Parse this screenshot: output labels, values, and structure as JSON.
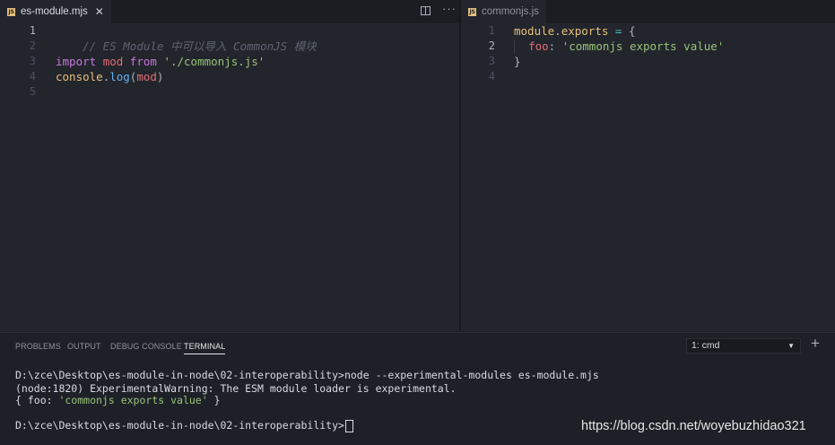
{
  "tabs": {
    "left": {
      "label": "es-module.mjs",
      "icon": "js-file-icon"
    },
    "right": {
      "label": "commonjs.js",
      "icon": "js-file-icon"
    },
    "close": "✕",
    "more": "···",
    "js_badge": "JS"
  },
  "left_editor": {
    "line_numbers": [
      "1",
      "2",
      "3",
      "4",
      "5"
    ],
    "line1_comment": "// ES Module 中可以导入 CommonJS 模块",
    "line3": {
      "kw1": "import",
      "var": "mod",
      "kw2": "from",
      "str": "'./commonjs.js'"
    },
    "line4": {
      "obj": "console",
      "dot": ".",
      "fn": "log",
      "open": "(",
      "var": "mod",
      "close": ")"
    }
  },
  "right_editor": {
    "line_numbers": [
      "1",
      "2",
      "3",
      "4"
    ],
    "line1": {
      "obj": "module",
      "dot": ".",
      "prop": "exports",
      "eq": " = ",
      "brace": "{"
    },
    "line2": {
      "prop": "foo",
      "colon": ": ",
      "str": "'commonjs exports value'"
    },
    "line3": "}"
  },
  "panel": {
    "tabs": [
      "PROBLEMS",
      "OUTPUT",
      "DEBUG CONSOLE",
      "TERMINAL"
    ],
    "terminal_select": "1: cmd",
    "plus": "+",
    "terminal_lines": [
      "D:\\zce\\Desktop\\es-module-in-node\\02-interoperability>node --experimental-modules es-module.mjs",
      "(node:1820) ExperimentalWarning: The ESM module loader is experimental.",
      "",
      "",
      "D:\\zce\\Desktop\\es-module-in-node\\02-interoperability>"
    ],
    "output_line": {
      "open": "{ foo: ",
      "str": "'commonjs exports value'",
      "close": " }"
    }
  },
  "watermark": "https://blog.csdn.net/woyebuzhidao321",
  "colors": {
    "background": "#23252c",
    "keyword": "#c678dd",
    "string": "#98c379",
    "variable": "#e06c75",
    "function": "#61afef",
    "comment": "#5c6370"
  }
}
